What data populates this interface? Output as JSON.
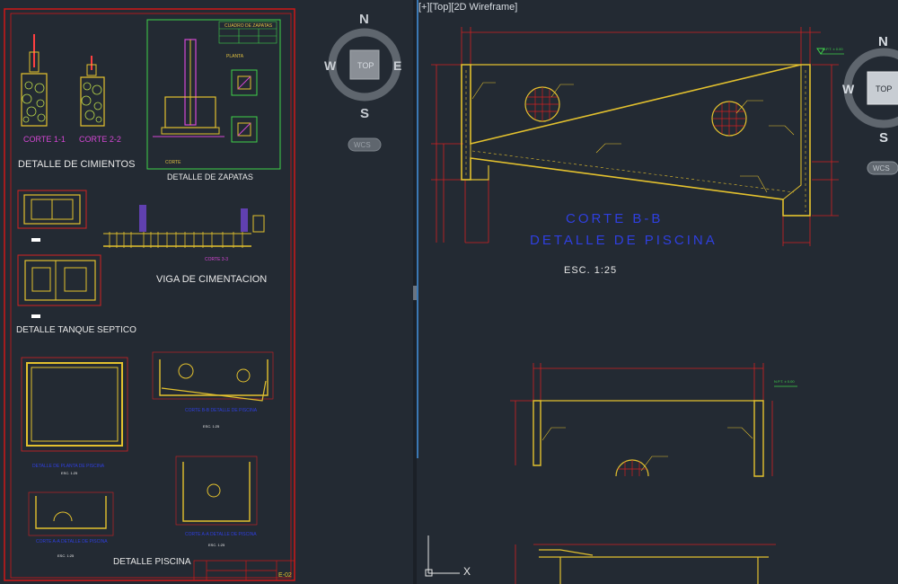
{
  "left_sheet": {
    "cimientos": {
      "corte1": "CORTE 1-1",
      "corte2": "CORTE 2-2",
      "title": "DETALLE DE CIMIENTOS"
    },
    "zapatas": {
      "table_title": "CUADRO DE ZAPATAS",
      "planta": "PLANTA",
      "corte": "CORTE",
      "title": "DETALLE DE ZAPATAS"
    },
    "viga": {
      "title": "VIGA DE CIMENTACION",
      "corte": "CORTE 3-3"
    },
    "tanque": {
      "title": "DETALLE TANQUE SEPTICO"
    },
    "piscina": {
      "label_planta": "DETALLE DE PLANTA DE PISCINA",
      "esc": "ESC. 1:25",
      "label_corte": "CORTE B-B DETALLE DE PISCINA",
      "label_aa": "CORTE A-A DETALLE DE PISCINA",
      "title": "DETALLE PISCINA"
    },
    "sheet_no": "E-02"
  },
  "compass_left": {
    "n": "N",
    "s": "S",
    "e": "E",
    "w": "W",
    "top": "TOP",
    "wcs": "WCS"
  },
  "compass_right": {
    "n": "N",
    "s": "S",
    "w": "W",
    "top": "TOP",
    "wcs": "WCS"
  },
  "right_view": {
    "viewport_label": "[+][Top][2D Wireframe]",
    "section_title_1": "CORTE B-B",
    "section_title_2": "DETALLE DE PISCINA",
    "scale": "ESC. 1:25",
    "ucs_x": "X",
    "npt_label": "N.P.T. ± 0.00"
  },
  "colors": {
    "background": "#232a33",
    "sheet_border": "#d01818",
    "wall": "#e3c12e",
    "dimension": "#d32222",
    "annotation_green": "#3fd24a",
    "title_blue": "#2f3fe0",
    "magenta": "#d447d4"
  }
}
